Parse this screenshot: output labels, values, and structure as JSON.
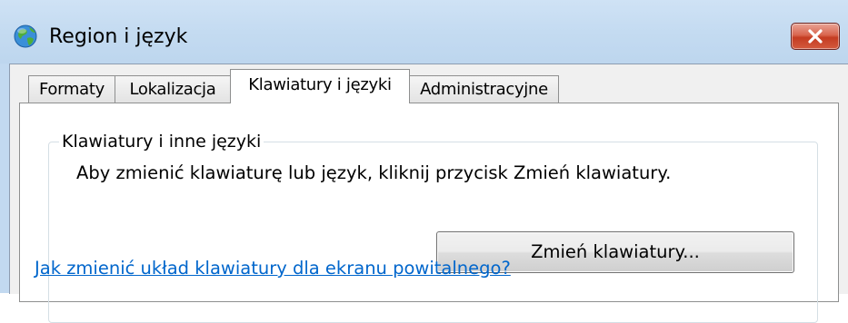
{
  "window": {
    "title": "Region i język",
    "icon": "globe-icon",
    "close_icon": "close-icon"
  },
  "tabs": [
    {
      "label": "Formaty",
      "active": false
    },
    {
      "label": "Lokalizacja",
      "active": false
    },
    {
      "label": "Klawiatury i języki",
      "active": true
    },
    {
      "label": "Administracyjne",
      "active": false
    }
  ],
  "keyboards_group": {
    "legend": "Klawiatury i inne języki",
    "instruction": "Aby zmienić klawiaturę lub język, kliknij przycisk Zmień klawiatury.",
    "change_button_label": "Zmień klawiatury...",
    "help_link": "Jak zmienić układ klawiatury dla ekranu powitalnego?"
  },
  "colors": {
    "title_bar": "#c4dbf1",
    "close_button": "#c43c22",
    "link": "#0066cc",
    "dialog_background": "#f0f0f0"
  }
}
